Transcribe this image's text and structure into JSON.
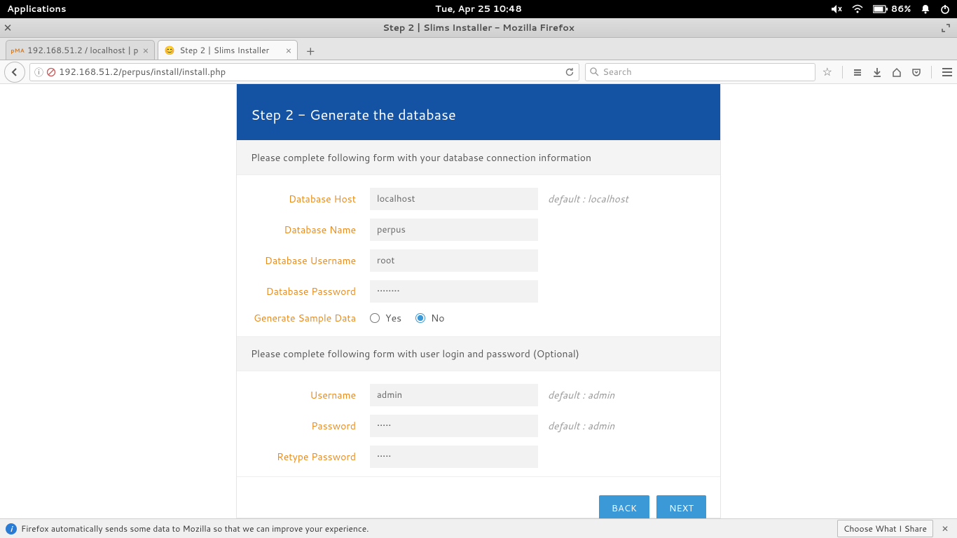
{
  "os_bar": {
    "applications": "Applications",
    "clock": "Tue, Apr 25   10:48",
    "battery": "86%"
  },
  "window": {
    "title": "Step 2 | Slims Installer - Mozilla Firefox"
  },
  "tabs": [
    {
      "label": "192.168.51.2 / localhost | p",
      "active": false
    },
    {
      "label": "Step 2 | Slims Installer",
      "active": true
    }
  ],
  "url": "192.168.51.2/perpus/install/install.php",
  "search_placeholder": "Search",
  "installer": {
    "heading": "Step 2 - Generate the database",
    "db_notice": "Please complete following form with your database connection information",
    "labels": {
      "db_host": "Database Host",
      "db_name": "Database Name",
      "db_user": "Database Username",
      "db_pass": "Database Password",
      "sample": "Generate Sample Data",
      "username": "Username",
      "password": "Password",
      "retype": "Retype Password"
    },
    "values": {
      "db_host": "localhost",
      "db_name": "perpus",
      "db_user": "root",
      "db_pass": "••••••••",
      "username": "admin",
      "password": "•••••",
      "retype": "•••••"
    },
    "help": {
      "db_host": "default : localhost",
      "username": "default : admin",
      "password": "default : admin"
    },
    "sample_yes": "Yes",
    "sample_no": "No",
    "sample_selected": "No",
    "user_notice": "Please complete following form with user login and password (Optional)",
    "back": "BACK",
    "next": "NEXT"
  },
  "footer": {
    "msg": "Firefox automatically sends some data to Mozilla so that we can improve your experience.",
    "choose": "Choose What I Share"
  }
}
